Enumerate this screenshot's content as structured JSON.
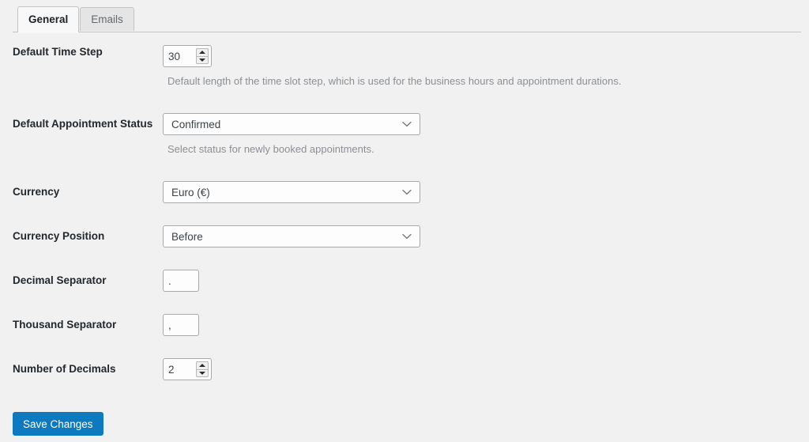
{
  "tabs": [
    {
      "id": "general",
      "label": "General",
      "active": true
    },
    {
      "id": "emails",
      "label": "Emails",
      "active": false
    }
  ],
  "fields": {
    "default_time_step": {
      "label": "Default Time Step",
      "value": "30",
      "help": "Default length of the time slot step, which is used for the business hours and appointment durations."
    },
    "default_appointment_status": {
      "label": "Default Appointment Status",
      "value": "Confirmed",
      "help": "Select status for newly booked appointments."
    },
    "currency": {
      "label": "Currency",
      "value": "Euro (€)"
    },
    "currency_position": {
      "label": "Currency Position",
      "value": "Before"
    },
    "decimal_separator": {
      "label": "Decimal Separator",
      "value": "."
    },
    "thousand_separator": {
      "label": "Thousand Separator",
      "value": ","
    },
    "number_of_decimals": {
      "label": "Number of Decimals",
      "value": "2"
    }
  },
  "actions": {
    "save_label": "Save Changes"
  },
  "icons": {
    "chevron_down": "chevron-down-icon",
    "spinner_up": "spinner-up-arrow-icon",
    "spinner_down": "spinner-down-arrow-icon"
  },
  "colors": {
    "accent": "#0d7ac0",
    "page_background": "#f1f1f1",
    "label_text": "#23282d",
    "help_text": "#8c8f94",
    "border": "#a7aaad"
  }
}
